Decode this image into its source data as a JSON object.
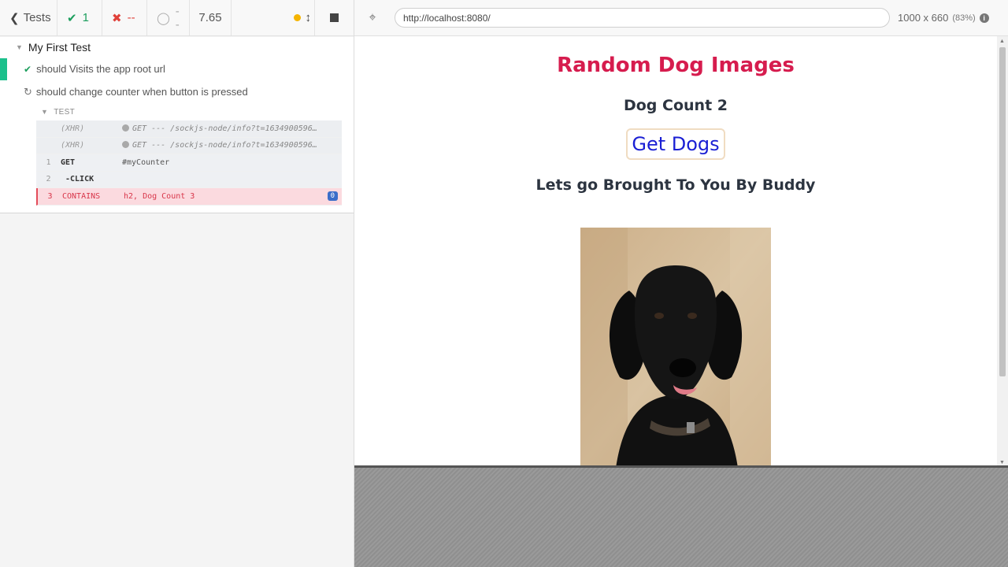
{
  "header": {
    "tests_label": "Tests",
    "passed": "1",
    "failed": "--",
    "pending": "--",
    "duration": "7.65"
  },
  "suite": {
    "title": "My First Test",
    "tests": [
      {
        "title": "should Visits the app root url",
        "state": "passed"
      },
      {
        "title": "should change counter when button is pressed",
        "state": "running"
      }
    ],
    "hook_label": "TEST",
    "commands": [
      {
        "num": "",
        "name": "(XHR)",
        "message": "GET --- /sockjs-node/info?t=1634900596…",
        "type": "xhr"
      },
      {
        "num": "",
        "name": "(XHR)",
        "message": "GET --- /sockjs-node/info?t=1634900596…",
        "type": "xhr"
      },
      {
        "num": "1",
        "name": "GET",
        "message": "#myCounter",
        "type": "normal"
      },
      {
        "num": "2",
        "name": "-CLICK",
        "message": "",
        "type": "child"
      },
      {
        "num": "3",
        "name": "CONTAINS",
        "message": "h2, Dog Count 3",
        "type": "failed",
        "badge": "0"
      }
    ]
  },
  "url_bar": {
    "url": "http://localhost:8080/",
    "viewport": "1000 x 660",
    "scale": "(83%)"
  },
  "app": {
    "title": "Random Dog Images",
    "count_text": "Dog Count 2",
    "button_label": "Get Dogs",
    "tagline": "Lets go Brought To You By Buddy"
  },
  "colors": {
    "pass": "#1c9e5d",
    "fail": "#e0413a",
    "title": "#d61c4e",
    "button_text": "#1a1fd4"
  }
}
